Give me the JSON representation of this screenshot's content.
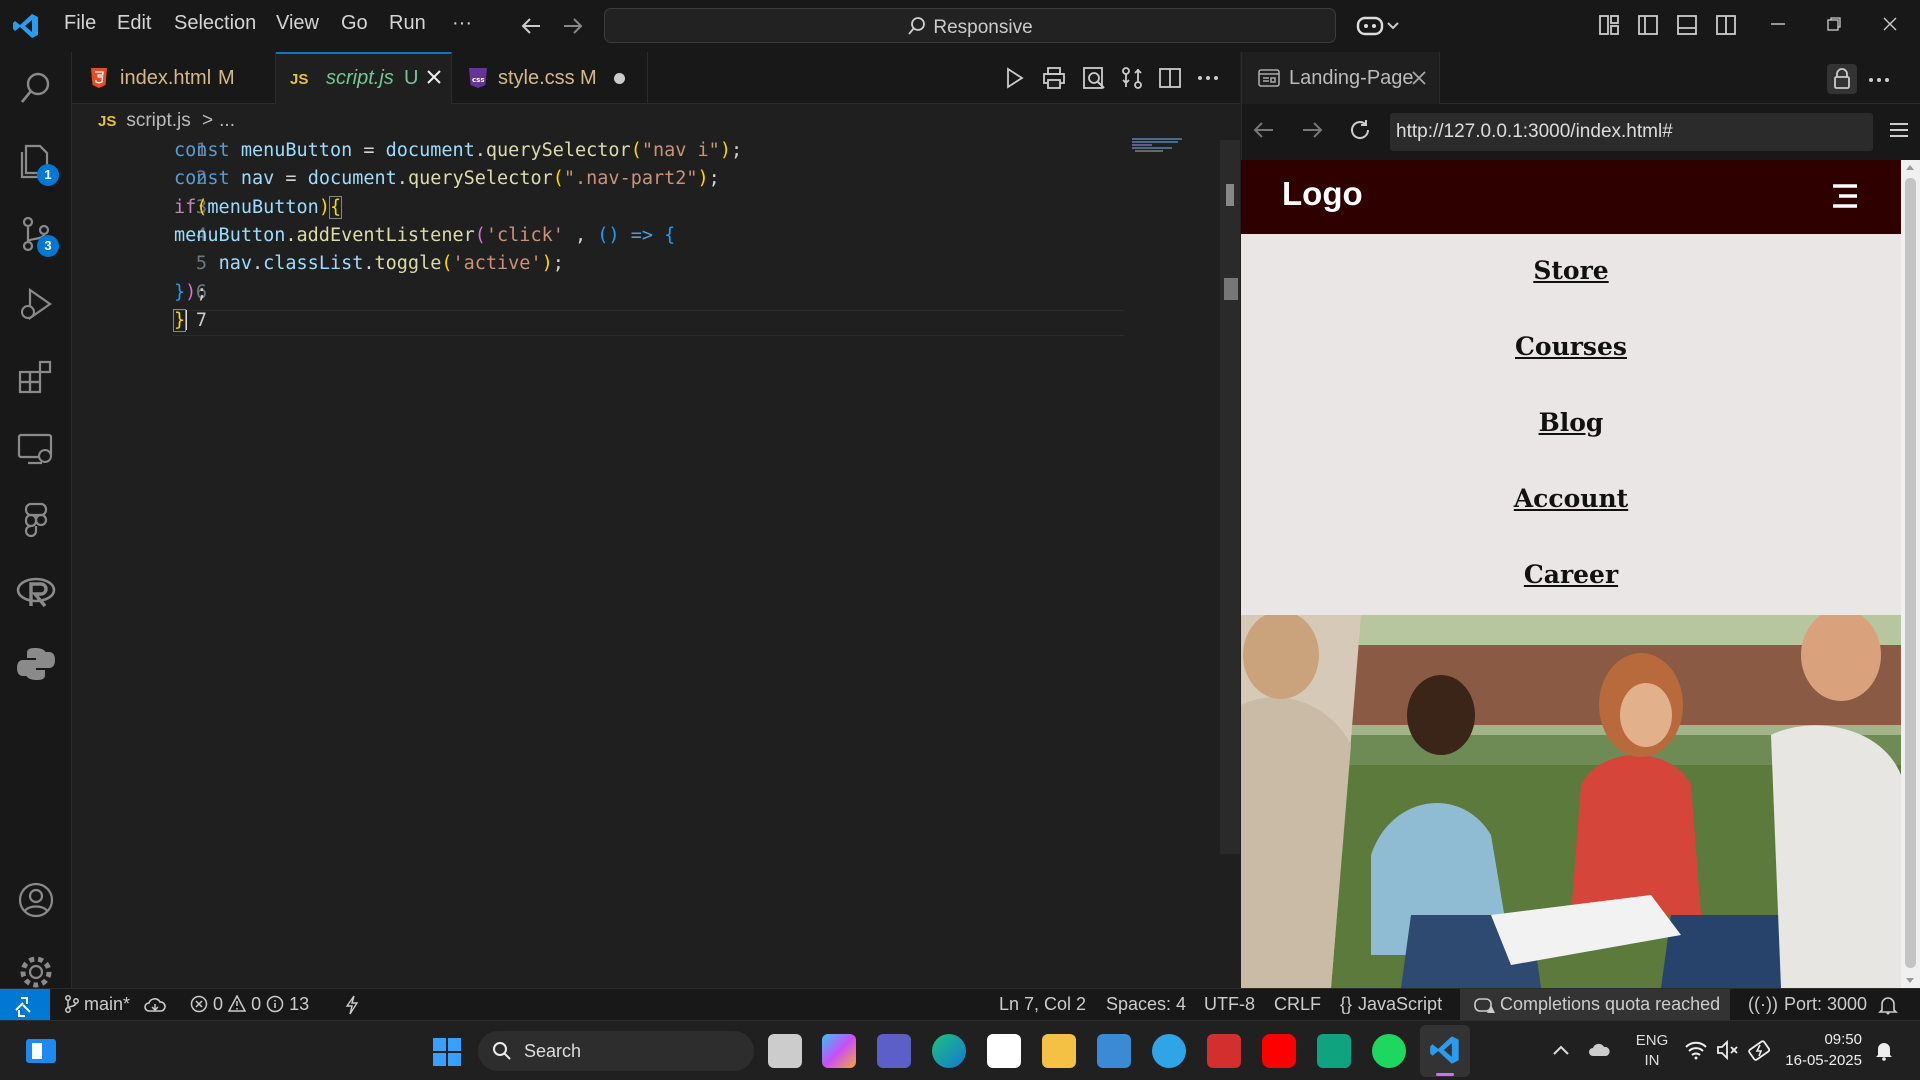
{
  "menu": [
    "File",
    "Edit",
    "Selection",
    "View",
    "Go",
    "Run",
    "···"
  ],
  "command_center": "Responsive",
  "activity_badges": {
    "explorer": "1",
    "source_control": "3"
  },
  "tabs": [
    {
      "name": "index.html",
      "status": "M",
      "icon": "html5-icon"
    },
    {
      "name": "script.js",
      "status": "U",
      "icon": "JS"
    },
    {
      "name": "style.css",
      "status": "M",
      "icon": "css"
    }
  ],
  "breadcrumb": {
    "file": "script.js",
    "sep": ">",
    "rest": "..."
  },
  "code_lines": [
    {
      "n": "1"
    },
    {
      "n": "2"
    },
    {
      "n": "3"
    },
    {
      "n": "4"
    },
    {
      "n": "5"
    },
    {
      "n": "6"
    },
    {
      "n": "7"
    }
  ],
  "browser": {
    "tab_title": "Landing-Page",
    "url": "http://127.0.0.1:3000/index.html#",
    "site_logo": "Logo",
    "nav_links": [
      "Store",
      "Courses",
      "Blog",
      "Account",
      "Career"
    ]
  },
  "status": {
    "branch": "main*",
    "errors": "0",
    "warnings": "0",
    "info": "13",
    "position": "Ln 7, Col 2",
    "spaces": "Spaces: 4",
    "encoding": "UTF-8",
    "eol": "CRLF",
    "language": "JavaScript",
    "completions": "Completions quota reached",
    "port": "Port: 3000"
  },
  "taskbar": {
    "search": "Search",
    "lang": "ENG",
    "region": "IN",
    "time": "09:50",
    "date": "16-05-2025"
  },
  "colors": {
    "accent": "#0078d4",
    "site_header": "#2e0000",
    "site_bg": "#ebe6e6"
  }
}
